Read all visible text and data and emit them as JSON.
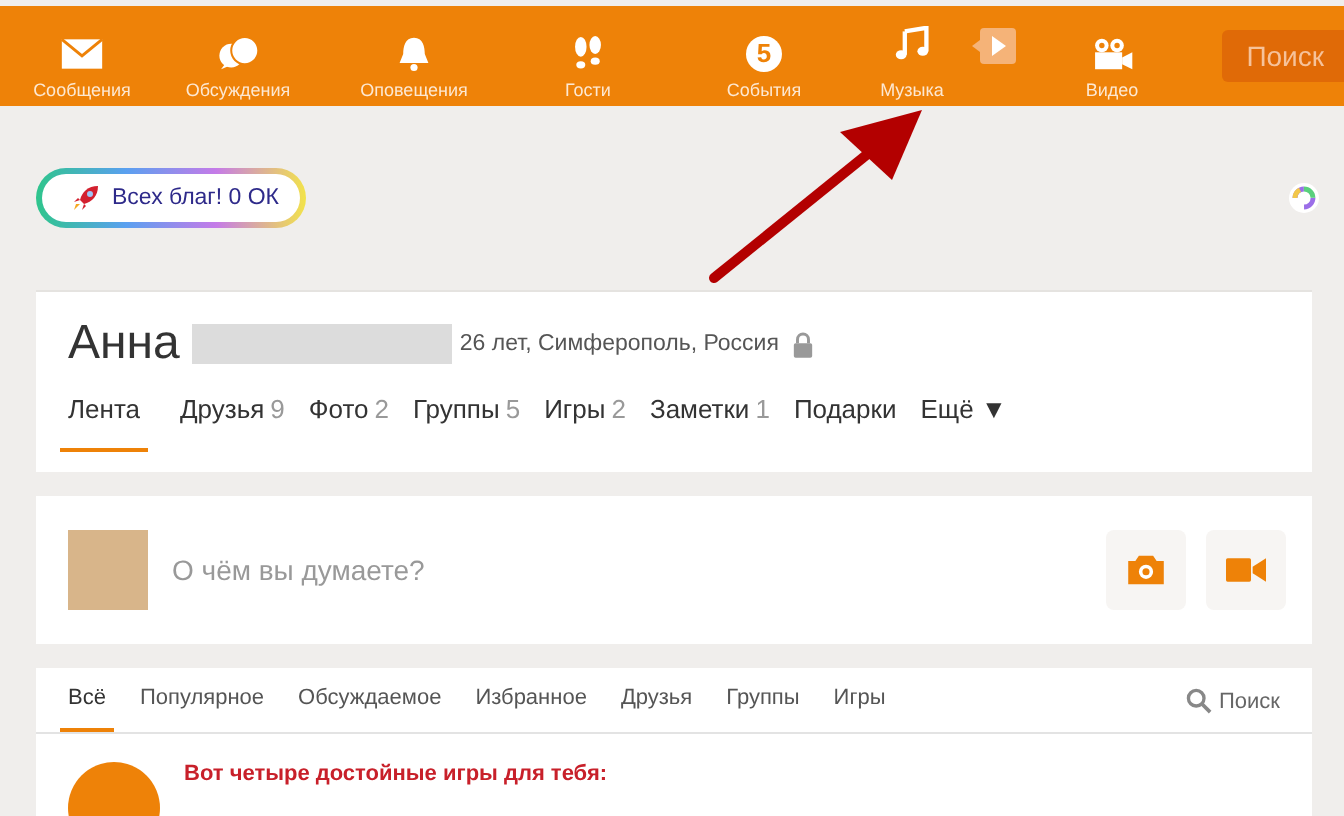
{
  "top_nav": {
    "items": [
      {
        "kind": "mail",
        "label": "Сообщения"
      },
      {
        "kind": "chat",
        "label": "Обсуждения"
      },
      {
        "kind": "bell",
        "label": "Оповещения"
      },
      {
        "kind": "steps",
        "label": "Гости"
      },
      {
        "kind": "events",
        "label": "События",
        "icon_text": "5"
      },
      {
        "kind": "music",
        "label": "Музыка"
      },
      {
        "kind": "video",
        "label": "Видео"
      }
    ],
    "search_button": "Поиск"
  },
  "promo_badge": {
    "label": "Всех благ! 0 ОК"
  },
  "profile": {
    "first_name": "Анна",
    "info": "26 лет, Симферополь, Россия",
    "tabs": [
      {
        "label": "Лента",
        "selected": true
      },
      {
        "label": "Друзья",
        "count": "9",
        "selected": false
      },
      {
        "label": "Фото",
        "count": "2",
        "selected": false
      },
      {
        "label": "Группы",
        "count": "5",
        "selected": false
      },
      {
        "label": "Игры",
        "count": "2",
        "selected": false
      },
      {
        "label": "Заметки",
        "count": "1",
        "selected": false
      },
      {
        "label": "Подарки",
        "selected": false
      },
      {
        "label": "Ещё ▼",
        "selected": false
      }
    ]
  },
  "composer": {
    "placeholder": "О чём вы думаете?"
  },
  "feed": {
    "tabs": [
      {
        "label": "Всё",
        "selected": true
      },
      {
        "label": "Популярное",
        "selected": false
      },
      {
        "label": "Обсуждаемое",
        "selected": false
      },
      {
        "label": "Избранное",
        "selected": false
      },
      {
        "label": "Друзья",
        "selected": false
      },
      {
        "label": "Группы",
        "selected": false
      },
      {
        "label": "Игры",
        "selected": false
      }
    ],
    "search": "Поиск",
    "post_title": "Вот четыре достойные игры для тебя:"
  }
}
